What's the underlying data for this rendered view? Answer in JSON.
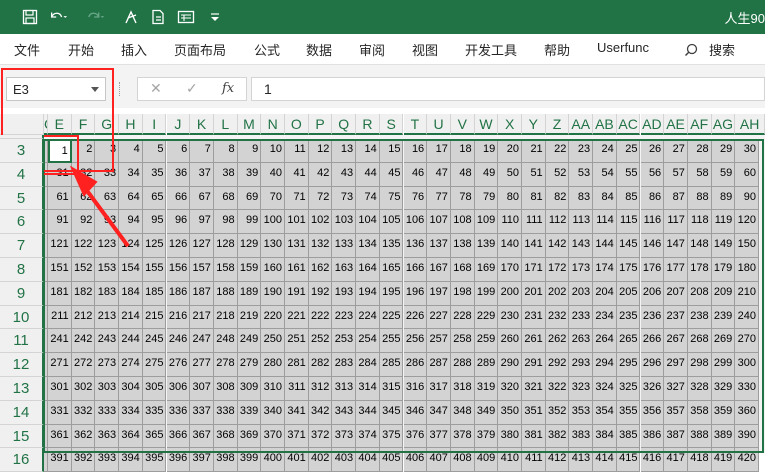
{
  "window": {
    "title": "人生90",
    "titlebar_color": "#217346"
  },
  "quick_access": [
    {
      "icon": "save-icon"
    },
    {
      "icon": "undo-icon"
    },
    {
      "icon": "redo-icon"
    },
    {
      "icon": "pen-icon"
    },
    {
      "icon": "document-icon"
    },
    {
      "icon": "form-icon"
    }
  ],
  "menu": {
    "items": [
      "文件",
      "开始",
      "插入",
      "页面布局",
      "公式",
      "数据",
      "审阅",
      "视图",
      "开发工具",
      "帮助",
      "Userfunc"
    ],
    "search_label": "搜索"
  },
  "formula_bar": {
    "name_box": "E3",
    "cancel_symbol": "✕",
    "enter_symbol": "✓",
    "fx_symbol": "fx",
    "value": "1"
  },
  "sheet": {
    "columns": [
      "C",
      "E",
      "F",
      "G",
      "H",
      "I",
      "J",
      "K",
      "L",
      "M",
      "N",
      "O",
      "P",
      "Q",
      "R",
      "S",
      "T",
      "U",
      "V",
      "W",
      "X",
      "Y",
      "Z",
      "AA",
      "AB",
      "AC",
      "AD",
      "AE",
      "AF",
      "AG",
      "AH"
    ],
    "rows": [
      "3",
      "4",
      "5",
      "6",
      "7",
      "8",
      "9",
      "10",
      "11",
      "12",
      "13",
      "14",
      "15",
      "16"
    ],
    "cells_per_row": 30,
    "start_value": 1,
    "active_cell": "E3",
    "accent_color": "#217346",
    "annotation_color": "#ff2020"
  }
}
